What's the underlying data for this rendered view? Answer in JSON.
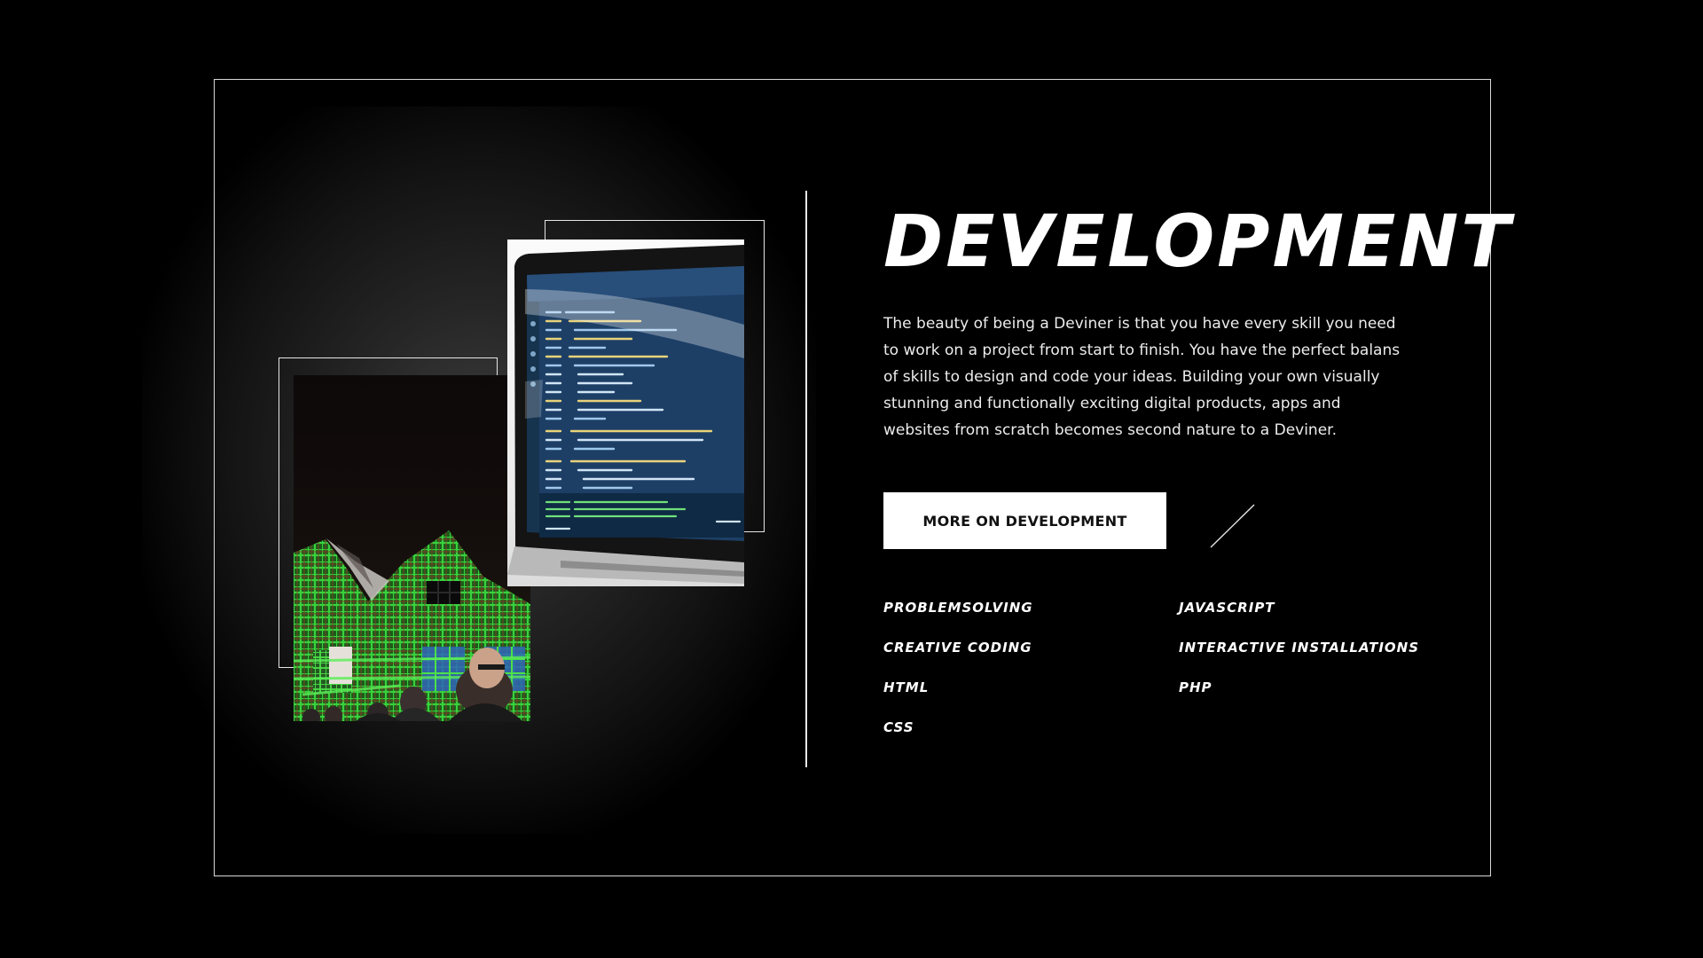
{
  "section": {
    "title": "DEVELOPMENT",
    "description": "The beauty of being a Deviner is that you have every skill you need to work on a project from start to finish. You have the perfect balans of skills to design and code your ideas. Building your own visually stunning and functionally exciting digital products, apps and websites from scratch becomes second nature to a Deviner.",
    "cta_label": "MORE ON DEVELOPMENT",
    "skills": [
      "PROBLEMSOLVING",
      "JAVASCRIPT",
      "CREATIVE CODING",
      "INTERACTIVE INSTALLATIONS",
      "HTML",
      "PHP",
      "CSS"
    ]
  },
  "images": {
    "left_photo": "projection-mapped-house-photo",
    "right_photo": "laptop-code-editor-photo"
  },
  "colors": {
    "background": "#000000",
    "text": "#ffffff",
    "button_background": "#ffffff",
    "button_text": "#111111",
    "frame_line": "#d8d8d8",
    "projection_green": "#2fbf3a"
  }
}
